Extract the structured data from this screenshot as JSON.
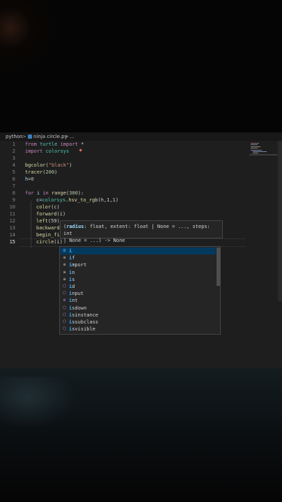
{
  "breadcrumb": {
    "folder": "python",
    "separator": ">",
    "file": "ninja circle.py",
    "more": "..."
  },
  "gutter": {
    "line_numbers": [
      "1",
      "2",
      "3",
      "4",
      "5",
      "6",
      "7",
      "8",
      "9",
      "10",
      "11",
      "12",
      "13",
      "14",
      "15"
    ]
  },
  "code": {
    "l1": {
      "kw1": "from",
      "mod": "turtle",
      "kw2": "import",
      "rest": "*"
    },
    "l2": {
      "kw": "import",
      "mod": "colorsys"
    },
    "l4": {
      "fn": "bgcolor",
      "open": "(",
      "str": "\"black\"",
      "close": ")"
    },
    "l5": {
      "fn": "tracer",
      "open": "(",
      "num": "200",
      "close": ")"
    },
    "l6": {
      "var": "h",
      "eq": "=",
      "num": "0"
    },
    "l8": {
      "kw1": "for",
      "var": "i",
      "kw2": "in",
      "fn": "range",
      "open": "(",
      "num": "300",
      "close": "):"
    },
    "l9": {
      "var": "c",
      "eq": "=",
      "mod": "colorsys",
      "dot": ".",
      "fn": "hsv_to_rgb",
      "args": "(h,1,1)"
    },
    "l10": {
      "fn": "color",
      "args": "(c)"
    },
    "l11": {
      "fn": "forward",
      "args": "(i)"
    },
    "l12": {
      "fn": "left",
      "args": "(59)"
    },
    "l13": {
      "fn": "backward"
    },
    "l14": {
      "fn": "begin_fi"
    },
    "l15": {
      "fn": "circle",
      "args": "(i)"
    }
  },
  "signature_help": {
    "open": "(",
    "p1": "radius",
    "t1": ": float, ",
    "p2": "extent",
    "t2": ": float | None = ..., ",
    "p3": "steps",
    "t3": ": int",
    "line2": "| None = ...) -> None"
  },
  "suggestions": [
    {
      "label": "i",
      "rest": "",
      "icon": "variable-icon",
      "selected": true
    },
    {
      "label": "i",
      "rest": "f",
      "icon": "keyword-icon"
    },
    {
      "label": "i",
      "rest": "mport",
      "icon": "keyword-icon"
    },
    {
      "label": "i",
      "rest": "n",
      "icon": "keyword-icon"
    },
    {
      "label": "i",
      "rest": "s",
      "icon": "keyword-icon"
    },
    {
      "label": "i",
      "rest": "d",
      "icon": "function-icon"
    },
    {
      "label": "i",
      "rest": "nput",
      "icon": "function-icon"
    },
    {
      "label": "i",
      "rest": "nt",
      "icon": "class-icon"
    },
    {
      "label": "i",
      "rest": "sdown",
      "icon": "function-icon"
    },
    {
      "label": "i",
      "rest": "sinstance",
      "icon": "function-icon"
    },
    {
      "label": "i",
      "rest": "ssubclass",
      "icon": "function-icon"
    },
    {
      "label": "i",
      "rest": "svisible",
      "icon": "function-icon"
    }
  ],
  "colors": {
    "editor_bg": "#1e1e1e",
    "keyword": "#c586c0",
    "string": "#ce9178",
    "number": "#b5cea8",
    "function": "#dcdcaa",
    "variable": "#9cdcfe",
    "match_highlight": "#2aaaff"
  }
}
